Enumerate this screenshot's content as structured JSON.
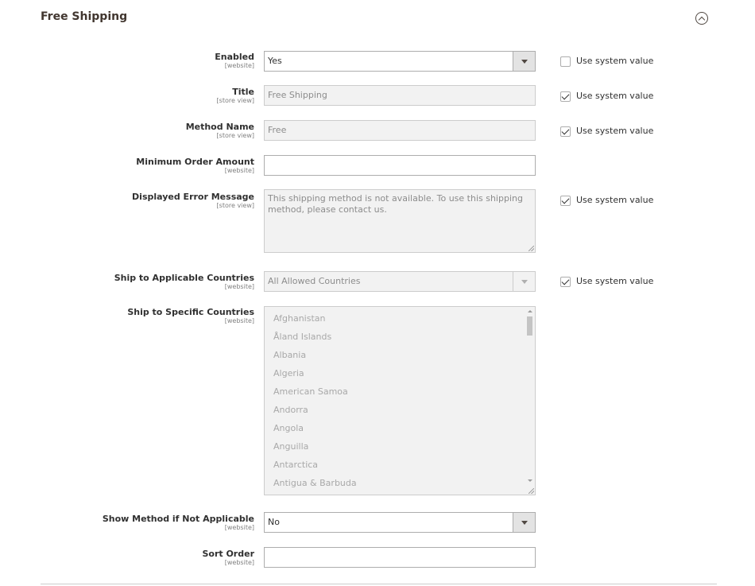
{
  "section": {
    "title": "Free Shipping",
    "collapse_icon": "chevron-up-circle-icon"
  },
  "use_system_value_label": "Use system value",
  "fields": {
    "enabled": {
      "label": "Enabled",
      "scope": "[website]",
      "value": "Yes",
      "use_system_value": false
    },
    "title": {
      "label": "Title",
      "scope": "[store view]",
      "value": "Free Shipping",
      "use_system_value": true
    },
    "method_name": {
      "label": "Method Name",
      "scope": "[store view]",
      "value": "Free",
      "use_system_value": true
    },
    "min_order_amount": {
      "label": "Minimum Order Amount",
      "scope": "[website]",
      "value": ""
    },
    "error_message": {
      "label": "Displayed Error Message",
      "scope": "[store view]",
      "value": "This shipping method is not available. To use this shipping method, please contact us.",
      "use_system_value": true
    },
    "applicable_countries": {
      "label": "Ship to Applicable Countries",
      "scope": "[website]",
      "value": "All Allowed Countries",
      "use_system_value": true
    },
    "specific_countries": {
      "label": "Ship to Specific Countries",
      "scope": "[website]",
      "options": [
        "Afghanistan",
        "Åland Islands",
        "Albania",
        "Algeria",
        "American Samoa",
        "Andorra",
        "Angola",
        "Anguilla",
        "Antarctica",
        "Antigua & Barbuda"
      ]
    },
    "show_method": {
      "label": "Show Method if Not Applicable",
      "scope": "[website]",
      "value": "No"
    },
    "sort_order": {
      "label": "Sort Order",
      "scope": "[website]",
      "value": ""
    }
  }
}
